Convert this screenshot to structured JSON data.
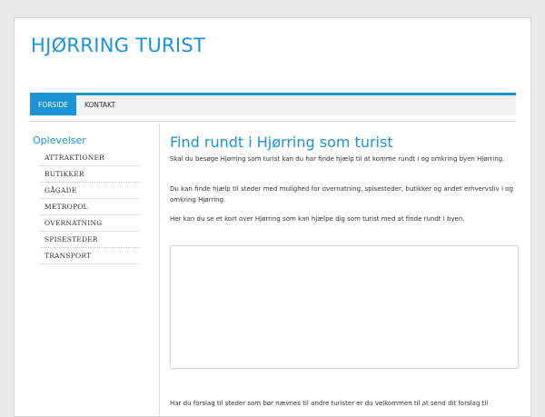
{
  "site": {
    "title": "HJØRRING TURIST"
  },
  "nav": {
    "items": [
      {
        "label": "FORSIDE"
      },
      {
        "label": "KONTAKT"
      }
    ]
  },
  "sidebar": {
    "title": "Oplevelser",
    "items": [
      {
        "label": "ATTRAKTIONER"
      },
      {
        "label": "BUTIKKER"
      },
      {
        "label": "GÅGADE"
      },
      {
        "label": "METROPOL"
      },
      {
        "label": "OVERNATNING"
      },
      {
        "label": "SPISESTEDER"
      },
      {
        "label": "TRANSPORT"
      }
    ]
  },
  "main": {
    "heading": "Find rundt i Hjørring som turist",
    "paragraphs": [
      "Skal du besøge Hjørring som turist kan du har finde hjælp til at komme rundt i og omkring byen Hjørring.",
      "Du kan finde hjælp til steder med mulighed for overnatning, spisesteder, butikker og andet erhvervsliv i og omkring Hjørring.",
      "Her kan du se et kort over Hjørring som kan hjælpe dig som turist med at finde rundt i byen."
    ],
    "footer_text": "Har du forslag til steder som bør nævnes til andre turister er du velkommen til at send dit forslag til"
  },
  "colors": {
    "accent": "#1c93d4",
    "page_bg": "#e9e9e9"
  }
}
